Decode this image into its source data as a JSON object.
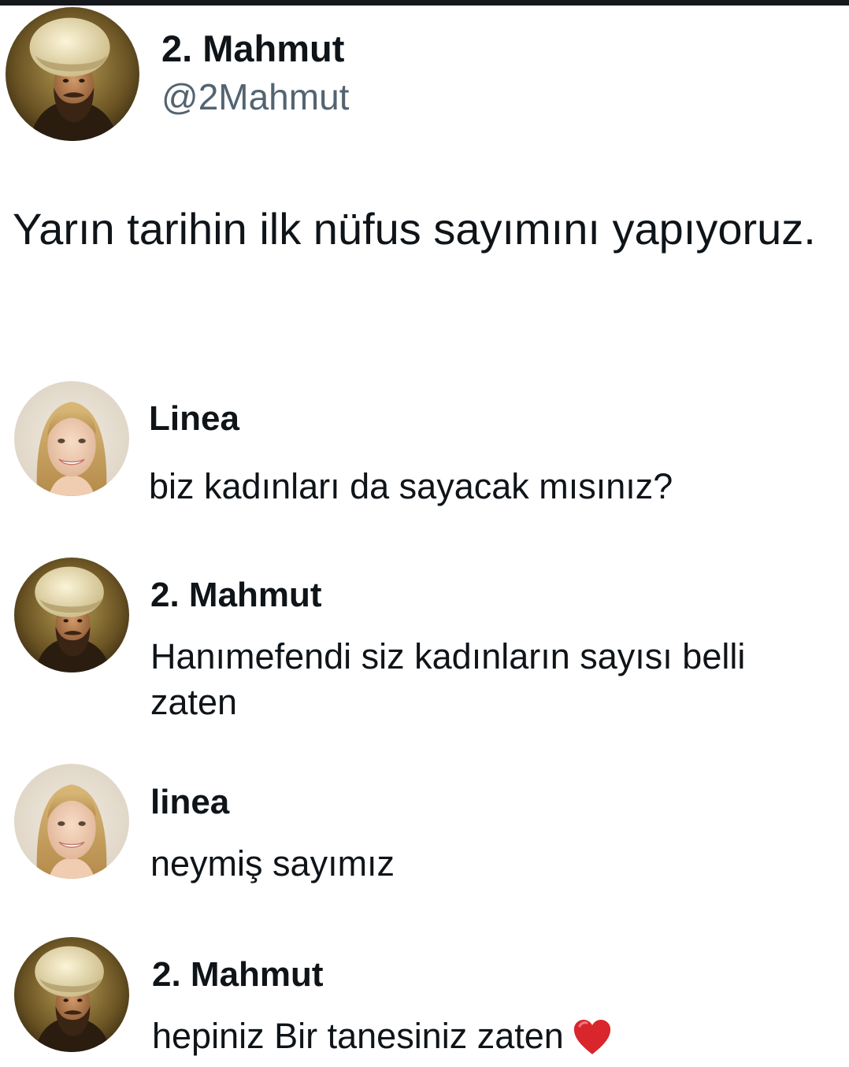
{
  "post": {
    "author_name": "2. Mahmut",
    "author_handle": "@2Mahmut",
    "text": "Yarın tarihin ilk nüfus sayımını yapıyoruz.",
    "avatar_icon": "sultan-portrait-avatar"
  },
  "replies": [
    {
      "name": "Linea",
      "text": "biz kadınları da sayacak mısınız?",
      "avatar_icon": "woman-portrait-avatar"
    },
    {
      "name": "2. Mahmut",
      "text": "Hanımefendi siz kadınların sayısı belli zaten",
      "avatar_icon": "sultan-portrait-avatar"
    },
    {
      "name": "linea",
      "text": "neymiş sayımız",
      "avatar_icon": "woman-portrait-avatar"
    },
    {
      "name": "2. Mahmut",
      "text": "hepiniz Bir tanesiniz zaten",
      "avatar_icon": "sultan-portrait-avatar",
      "trailing_icon": "red-heart-icon"
    }
  ],
  "colors": {
    "text_primary": "#0f1419",
    "text_secondary": "#536471",
    "heart": "#d9262c"
  }
}
